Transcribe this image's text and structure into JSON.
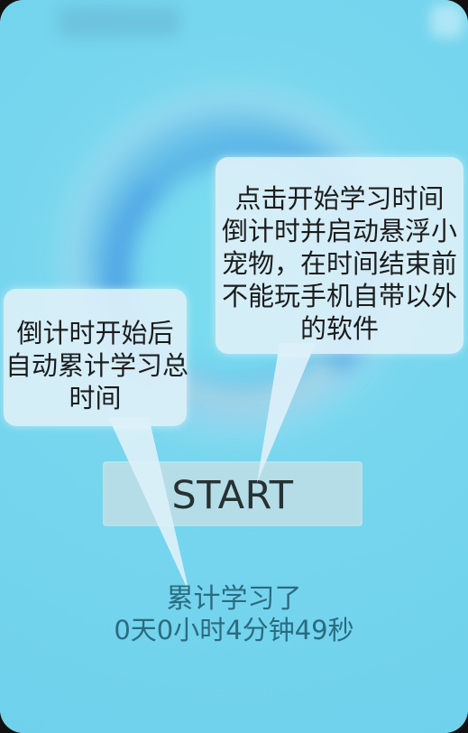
{
  "main": {
    "start_label": "START"
  },
  "tips": {
    "right_bubble_lines": [
      "点击开始学习时间",
      "倒计时并启动悬浮小",
      "宠物，在时间结束前",
      "不能玩手机自带以外",
      "的软件"
    ],
    "left_bubble_lines": [
      "倒计时开始后",
      "自动累计学习总",
      "时间"
    ]
  },
  "stats": {
    "label": "累计学习了",
    "total_time": "0天0小时4分钟49秒"
  },
  "colors": {
    "background": "#7fd7ee",
    "bubble": "#dcf0f8",
    "text_dark": "#1c1c1c",
    "text_footer": "#2b6b80"
  }
}
